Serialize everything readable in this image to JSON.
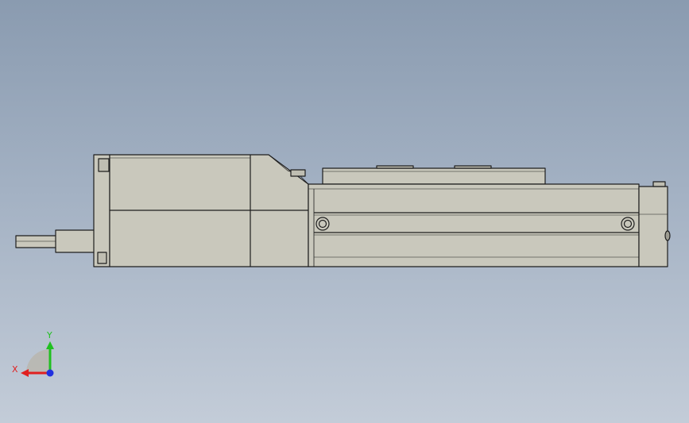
{
  "viewport": {
    "background_top": "#8a9bb0",
    "background_bottom": "#c3ccd8"
  },
  "model": {
    "body_color": "#c9c8bc",
    "edge_color": "#1e1e1e"
  },
  "triad": {
    "x_label": "X",
    "y_label": "Y",
    "x_color": "#e02020",
    "y_color": "#20c020",
    "z_color": "#2030e0"
  }
}
